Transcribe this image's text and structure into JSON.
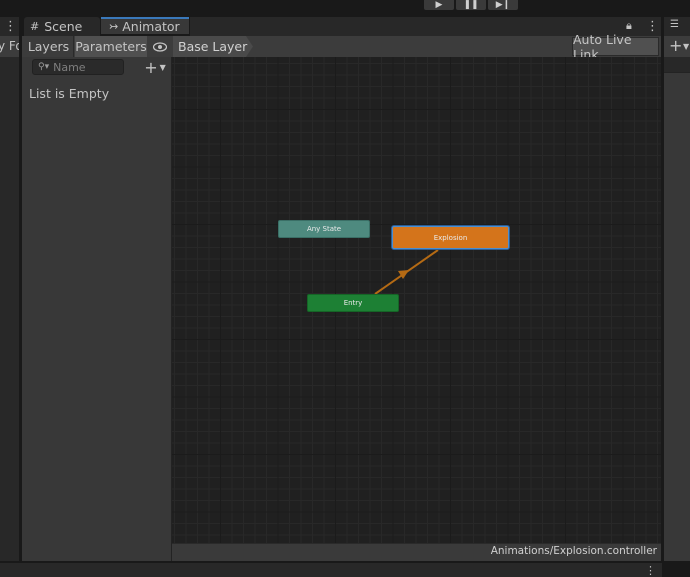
{
  "play_controls": {
    "play_icon": "play-icon",
    "pause_icon": "pause-icon",
    "step_icon": "step-icon"
  },
  "left_panel": {
    "partial_label": "y Fo"
  },
  "tabs": [
    {
      "label": "Scene",
      "icon": "grid-icon"
    },
    {
      "label": "Animator",
      "icon": "animator-icon"
    }
  ],
  "toolbar": {
    "layers_label": "Layers",
    "parameters_label": "Parameters",
    "breadcrumb": "Base Layer",
    "auto_live_link": "Auto Live Link"
  },
  "parameters_panel": {
    "search_placeholder": "Name",
    "empty_text": "List is Empty"
  },
  "graph": {
    "nodes": [
      {
        "label": "Any State",
        "color": "#4e8a7f"
      },
      {
        "label": "Explosion",
        "color": "#d4741b"
      },
      {
        "label": "Entry",
        "color": "#1d8034"
      }
    ],
    "transition_color": "#b46a14"
  },
  "status": {
    "path": "Animations/Explosion.controller"
  },
  "accent_color": "#3a79bb"
}
